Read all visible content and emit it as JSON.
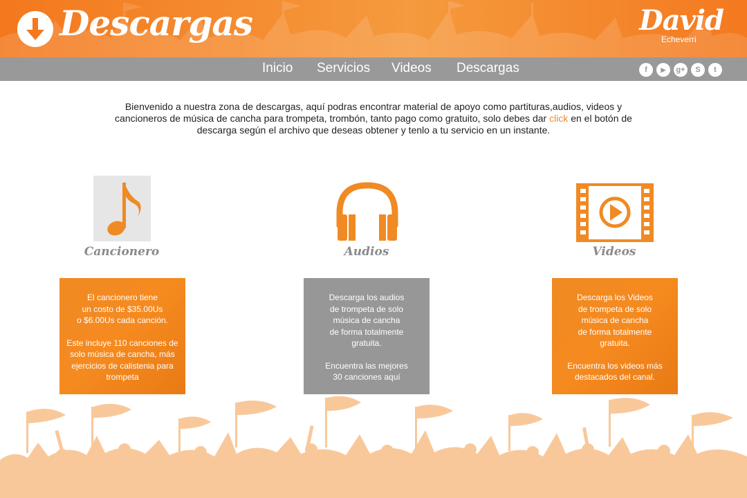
{
  "header": {
    "title": "Descargas",
    "logo_name": "David",
    "logo_sub": "Echeverri"
  },
  "nav": {
    "items": [
      "Inicio",
      "Servicios",
      "Videos",
      "Descargas"
    ]
  },
  "social": [
    {
      "icon": "facebook-icon",
      "glyph": "f"
    },
    {
      "icon": "youtube-icon",
      "glyph": "▶"
    },
    {
      "icon": "google-plus-icon",
      "glyph": "g+"
    },
    {
      "icon": "skype-icon",
      "glyph": "S"
    },
    {
      "icon": "twitter-icon",
      "glyph": "t"
    }
  ],
  "intro": {
    "before_click": "Bienvenido a nuestra zona de descargas, aquí podras encontrar material de apoyo como partituras,audios, videos y cancioneros de música de cancha para trompeta, trombón, tanto pago como gratuito, solo debes dar ",
    "click": "click",
    "after_click": " en el botón de descarga según el archivo que deseas obtener y tenlo a tu servicio en un instante."
  },
  "categories": [
    {
      "label": "Cancionero",
      "icon": "music-note-icon",
      "para1": "El cancionero tiene\nun costo de $35.00Us\no $6.00Us cada canción.",
      "para2": "Este incluye 110 canciones de\nsolo música de cancha, más\nejercicios de calistenia para\ntrompeta"
    },
    {
      "label": "Audios",
      "icon": "headphones-icon",
      "para1": "Descarga los audios\nde  trompeta de solo\nmúsica de cancha\nde forma totalmente\ngratuita.",
      "para2": "Encuentra las mejores\n30 canciones aquí"
    },
    {
      "label": "Videos",
      "icon": "video-film-icon",
      "para1": "Descarga los Videos\nde  trompeta de solo\nmúsica de cancha\nde forma totalmente\ngratuita.",
      "para2": "Encuentra los videos más\ndestacados del canal."
    }
  ],
  "colors": {
    "accent": "#f4781d",
    "nav_bg": "#999999",
    "card_orange": "#f08a24",
    "card_gray": "#979797",
    "crowd": "#f9c89a"
  }
}
